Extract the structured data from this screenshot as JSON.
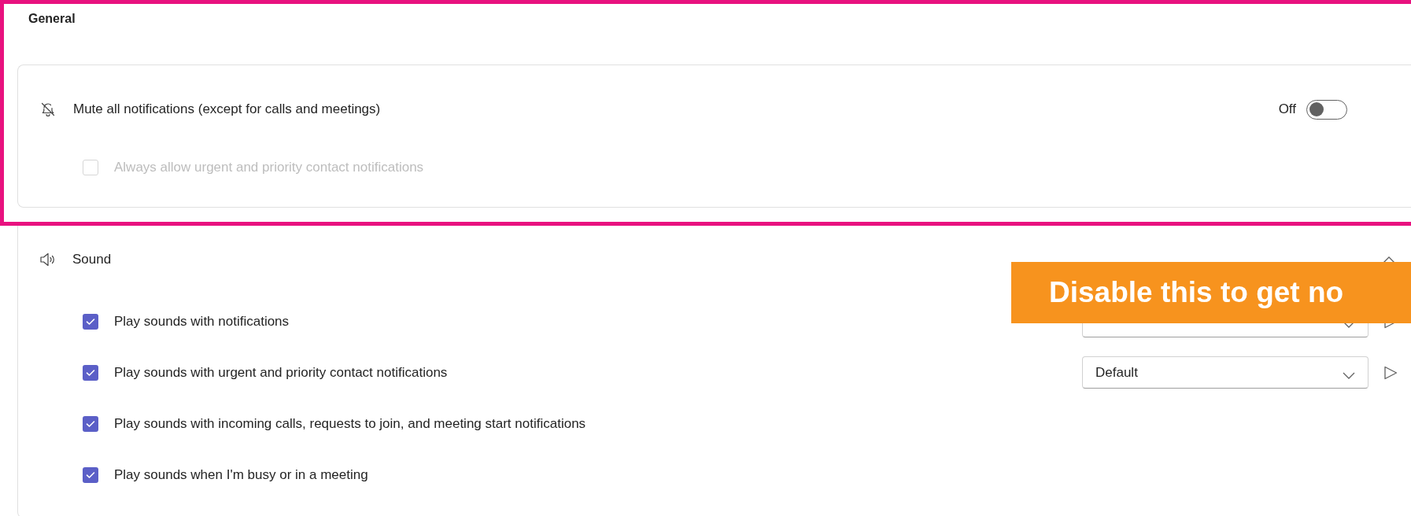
{
  "general": {
    "title": "General",
    "mute": {
      "label": "Mute all notifications (except for calls and meetings)",
      "state_label": "Off",
      "on": false
    },
    "urgent_option": {
      "label": "Always allow urgent and priority contact notifications",
      "checked": false,
      "disabled": true
    }
  },
  "sound": {
    "title": "Sound",
    "expanded": true,
    "options": [
      {
        "kind": "dropdown",
        "label": "Play sounds with notifications",
        "checked": true
      },
      {
        "kind": "dropdown",
        "label": "Play sounds with urgent and priority contact notifications",
        "checked": true,
        "dropdown": "Default"
      },
      {
        "kind": "plain",
        "label": "Play sounds with incoming calls, requests to join, and meeting start notifications",
        "checked": true
      },
      {
        "kind": "plain",
        "label": "Play sounds when I'm busy or in a meeting",
        "checked": true
      }
    ]
  },
  "callout": {
    "text": "Disable this to get no"
  }
}
